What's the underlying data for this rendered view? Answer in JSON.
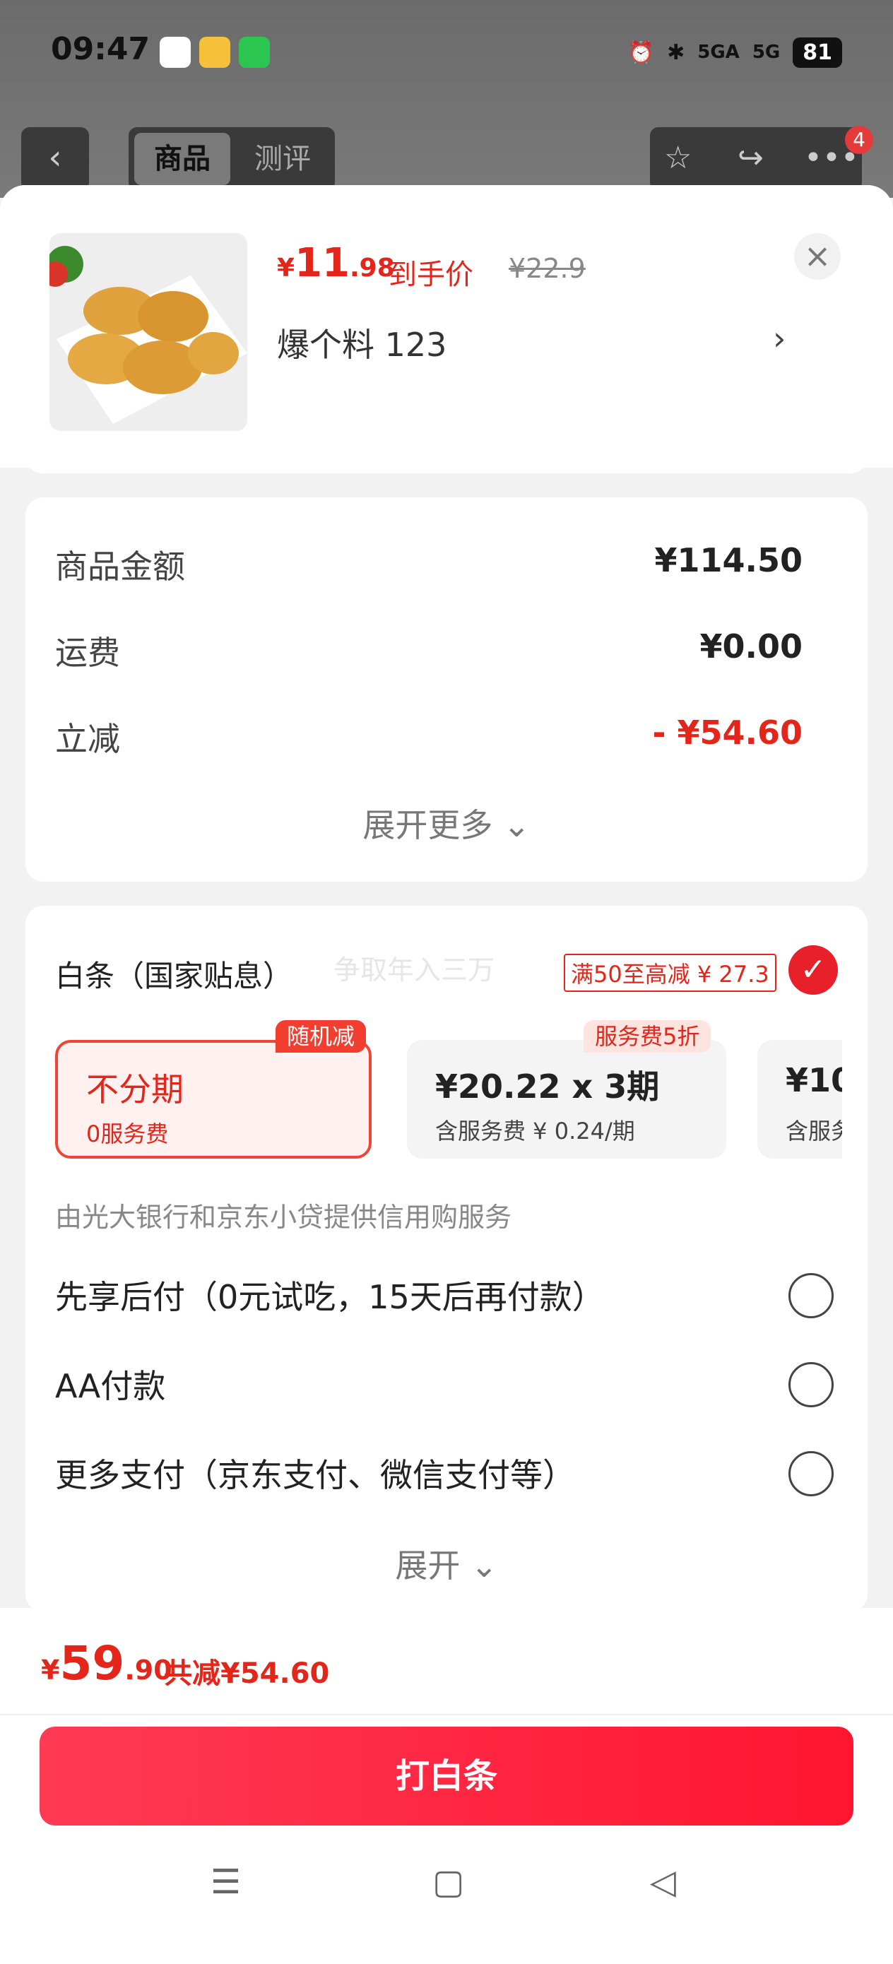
{
  "status_bar": {
    "time": "09:47",
    "battery": "81",
    "signal1": "5GA",
    "signal2": "5G"
  },
  "nav": {
    "back_glyph": "‹",
    "tabs": [
      {
        "label": "商品"
      },
      {
        "label": "测评"
      }
    ],
    "badge": "4"
  },
  "product": {
    "price_currency": "¥",
    "price_int": "11",
    "price_dec": ".98",
    "price_tag": "到手价",
    "original_price": "¥22.9",
    "spec": "爆个料 123",
    "spec_chevron": "›",
    "close_glyph": "×"
  },
  "amounts": {
    "rows": [
      {
        "label": "商品金额",
        "value": "¥114.50"
      },
      {
        "label": "运费",
        "value": "¥0.00"
      },
      {
        "label": "立减",
        "value": "- ¥54.60"
      }
    ],
    "expand_label": "展开更多 ⌄"
  },
  "payment": {
    "title": "白条（国家贴息）",
    "watermark": "争取年入三万",
    "promo": "满50至高减 ¥ 27.3",
    "plans": [
      {
        "tag": "随机减",
        "main": "不分期",
        "sub": "0服务费"
      },
      {
        "tag": "服务费5折",
        "main": "¥20.22 x 3期",
        "sub": "含服务费 ¥ 0.24/期"
      },
      {
        "tag": "",
        "main": "¥10",
        "sub": "含服务"
      }
    ],
    "provider": "由光大银行和京东小贷提供信用购服务",
    "options": [
      {
        "label": "先享后付（0元试吃，15天后再付款）"
      },
      {
        "label": "AA付款"
      },
      {
        "label": "更多支付（京东支付、微信支付等）"
      }
    ],
    "expand_label": "展开 ⌄"
  },
  "footer": {
    "total_currency": "¥",
    "total_int": "59",
    "total_dec": ".90",
    "total_save": "共减¥54.60",
    "pay_button": "打白条"
  },
  "colors": {
    "accent": "#e3251a",
    "button": "#ff2440"
  }
}
